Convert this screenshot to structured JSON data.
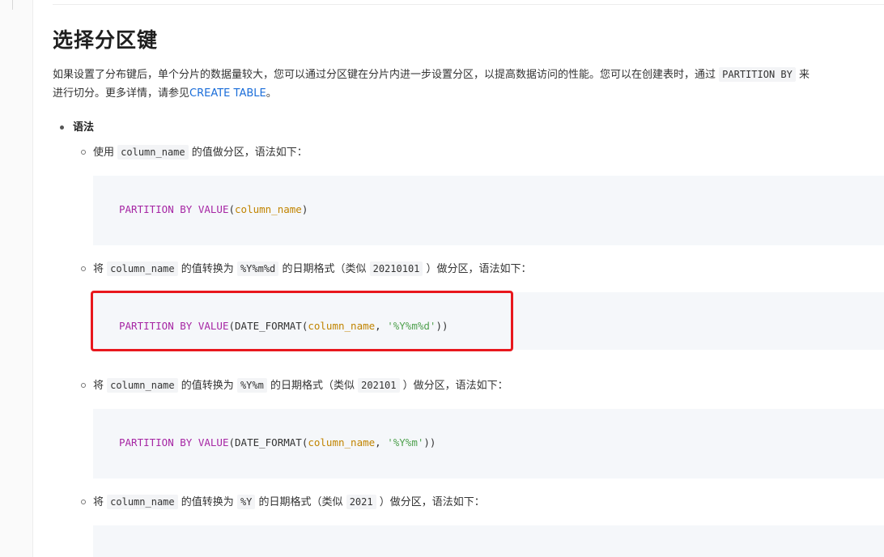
{
  "title": "选择分区键",
  "intro": {
    "line1_text": "如果设置了分布键后，单个分片的数据量较大，您可以通过分区键在分片内进一步设置分区，以提高数据访问的性能。您可以在创建表时，通过",
    "line1_code": "PARTITION BY",
    "line1_tail": "来",
    "line2_text": "进行切分。更多详情，请参见",
    "line2_link": "CREATE TABLE",
    "line2_end": "。"
  },
  "section": {
    "label": "语法"
  },
  "items": [
    {
      "prefix": "使用",
      "code1": "column_name",
      "middle": "的值做分区，语法如下：",
      "code2": "",
      "tail": "",
      "syntax": {
        "kw1": "PARTITION",
        "kw2": "BY",
        "kw3": "VALUE",
        "fn": "",
        "arg": "column_name",
        "str": "",
        "close": ")"
      }
    },
    {
      "prefix": "将",
      "code1": "column_name",
      "middle": "的值转换为",
      "code2": "%Y%m%d",
      "example_prefix": "的日期格式（类似",
      "example": "20210101",
      "tail": "）做分区，语法如下：",
      "syntax": {
        "kw1": "PARTITION",
        "kw2": "BY",
        "kw3": "VALUE",
        "fn": "DATE_FORMAT",
        "arg": "column_name",
        "str": "'%Y%m%d'",
        "close": "))"
      }
    },
    {
      "prefix": "将",
      "code1": "column_name",
      "middle": "的值转换为",
      "code2": "%Y%m",
      "example_prefix": "的日期格式（类似",
      "example": "202101",
      "tail": "）做分区，语法如下：",
      "syntax": {
        "kw1": "PARTITION",
        "kw2": "BY",
        "kw3": "VALUE",
        "fn": "DATE_FORMAT",
        "arg": "column_name",
        "str": "'%Y%m'",
        "close": "))"
      }
    },
    {
      "prefix": "将",
      "code1": "column_name",
      "middle": "的值转换为",
      "code2": "%Y",
      "example_prefix": "的日期格式（类似",
      "example": "2021",
      "tail": "）做分区，语法如下："
    }
  ],
  "colors": {
    "keyword": "#a626a4",
    "identifier": "#c18401",
    "string": "#50a14f",
    "link": "#1a6dd9",
    "highlight": "#e8171d"
  }
}
